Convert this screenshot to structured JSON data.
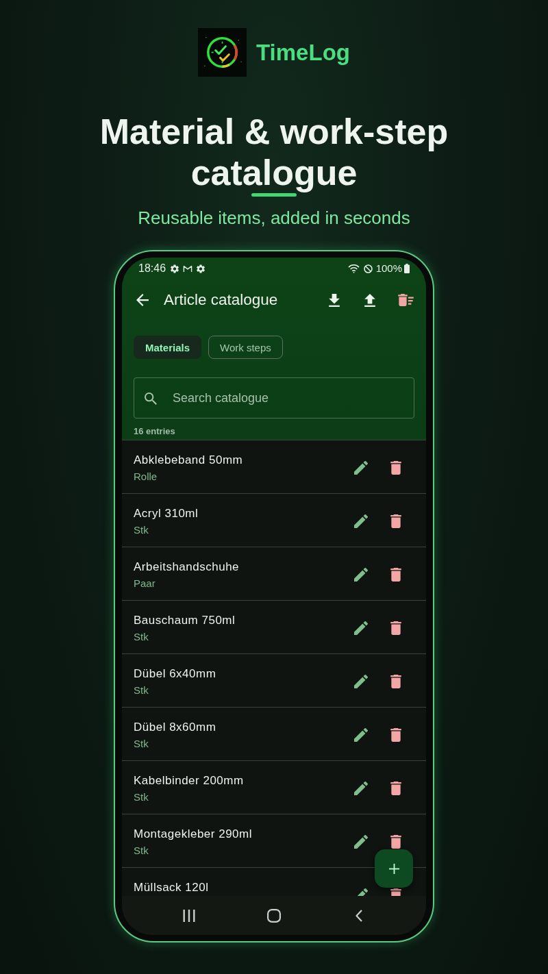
{
  "brand": {
    "name": "TimeLog"
  },
  "headline": "Material & work-step catalogue",
  "subtitle": "Reusable items, added in seconds",
  "status_bar": {
    "time": "18:46",
    "battery": "100%"
  },
  "app_bar": {
    "title": "Article catalogue"
  },
  "tabs": [
    {
      "label": "Materials",
      "selected": true
    },
    {
      "label": "Work steps",
      "selected": false
    }
  ],
  "search": {
    "placeholder": "Search catalogue"
  },
  "entry_count": "16 entries",
  "items": [
    {
      "name": "Abklebeband 50mm",
      "unit": "Rolle"
    },
    {
      "name": "Acryl 310ml",
      "unit": "Stk"
    },
    {
      "name": "Arbeitshandschuhe",
      "unit": "Paar"
    },
    {
      "name": "Bauschaum 750ml",
      "unit": "Stk"
    },
    {
      "name": "Dübel 6x40mm",
      "unit": "Stk"
    },
    {
      "name": "Dübel 8x60mm",
      "unit": "Stk"
    },
    {
      "name": "Kabelbinder 200mm",
      "unit": "Stk"
    },
    {
      "name": "Montagekleber 290ml",
      "unit": "Stk"
    },
    {
      "name": "Müllsack 120l"
    }
  ]
}
